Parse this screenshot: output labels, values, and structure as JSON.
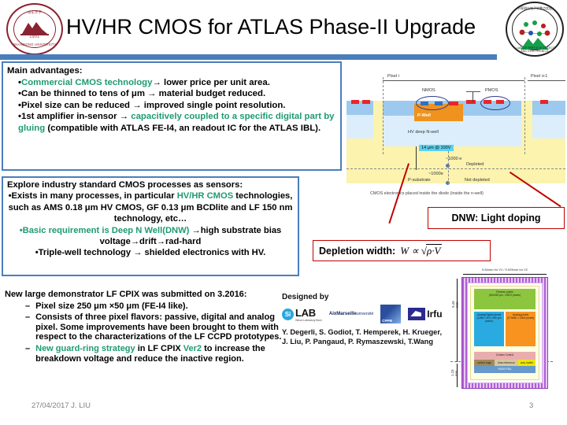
{
  "header": {
    "title": "HV/HR CMOS for ATLAS Phase-II Upgrade",
    "left_logo_name": "Shandong University seal",
    "left_logo_year": "1901",
    "left_logo_arc_bottom": "SHANDONG UNIVERSITY",
    "left_logo_arc_top": "山东大学",
    "right_logo_name": "Key Laboratory of Particle Detection and Electronics",
    "right_logo_cn": "粒子探测与电子学重点实验室",
    "right_logo_en": "KEY LAB OF PARTICLE DETECTION AND ELECTRONICS",
    "accent_color": "#4a7ebb"
  },
  "box_main": {
    "heading": "Main advantages:",
    "bullets": [
      {
        "lead": "•",
        "green1": "Commercial CMOS technology",
        "arrow": "→",
        "rest": " lower price per unit area."
      },
      {
        "lead": "•",
        "plain": "Can be thinned to tens of μm ",
        "arrow": "→",
        "rest": " material budget reduced."
      },
      {
        "lead": "•",
        "plain": "Pixel size can be reduced ",
        "arrow": "→",
        "rest": " improved single point resolution."
      },
      {
        "lead": "•",
        "plain": "1st amplifier in-sensor ",
        "arrow": "→",
        "green1": " capacitively coupled to a specific digital part by gluing",
        "rest": " (compatible with ATLAS FE-I4, an readout IC for the ATLAS IBL)."
      }
    ]
  },
  "box_explore": {
    "heading": "Explore industry standard CMOS processes as sensors:",
    "b1_pre": "•Exists in many processes, in particular ",
    "b1_green": "HV/HR CMOS",
    "b1_rest": "technologies, such as AMS 0.18 μm HV CMOS, GF 0.13 μm BCDlite and LF 150 nm technology, etc…",
    "b2_green": "•Basic requirement is Deep N Well(DNW) ",
    "b2_arrow": "→",
    "b2_rest": "high substrate bias voltage→drift→rad-hard",
    "b3": "•Triple-well technology → shielded electronics with HV."
  },
  "box_demo": {
    "heading": "New large demonstrator LF CPIX was submitted on 3.2016:",
    "items": [
      {
        "dash": "–",
        "text": "Pixel size 250 μm ×50 μm (FE-I4 like)."
      },
      {
        "dash": "–",
        "text": "Consists of three pixel flavors: passive, digital and analog pixel. Some improvements have been brought to them with respect to the characterizations of the LF CCPD prototypes."
      },
      {
        "dash": "–",
        "green_pre": "New guard-ring strategy",
        "mid": " in LF CPIX ",
        "green_mid": "Ver2",
        "rest": " to increase the breakdown voltage and reduce the inactive region."
      }
    ]
  },
  "xsection": {
    "pixel_i": "Pixel i",
    "pixel_i1": "Pixel i+1",
    "nmos": "NMOS",
    "pmos": "PMOS",
    "pwell": "P-Well",
    "hv_deep_nwell": "HV deep N-well",
    "depth_chip": "14 μm @ 100V",
    "e_top": "~1000 e",
    "e_bottom": "~1000e",
    "depleted": "Depleted",
    "not_depleted": "Not depleted",
    "p_substrate": "P-substrate",
    "caption": "CMOS electronics placed inside the diode (inside the n-well)"
  },
  "callouts": {
    "dnw_label": "DNW: Light doping",
    "depletion_label": "Depletion width:",
    "depletion_formula_w": "W",
    "depletion_formula_prop": "∝",
    "depletion_formula_body": "ρ·V",
    "border_color": "#c00000"
  },
  "designed": {
    "heading": "Designed by",
    "logos": [
      {
        "name": "silab-logo",
        "mark": "Si",
        "text": "LAB",
        "sub": "Silicon Laboratory Bonn"
      },
      {
        "name": "aix-marseille-universite-logo",
        "line1": "Aix",
        "line2": "Marseille",
        "line3": "université"
      },
      {
        "name": "cppm-logo",
        "text": "CPPM"
      },
      {
        "name": "irfu-logo",
        "text": "Irfu"
      }
    ],
    "authors_line1": "Y. Degerli, S. Godiot, T. Hemperek, H. Krueger,",
    "authors_line2": "J. Liu, P. Pangaud, P. Rymaszewski, T.Wang"
  },
  "chip_layout": {
    "dim_top": "9.84mm for V1 / 9.925mm for V2",
    "dim_left_1": "9.49 mm",
    "dim_left_2": "1.15 mm",
    "blocks": [
      {
        "name": "passive-pixels",
        "title": "Passive pixels",
        "sub": "(50x250 μm, 13872 pixels)"
      },
      {
        "name": "analog-digital-pixels",
        "title": "Analog/Digital pixels",
        "sub": "(1286 x 50 x 250 μm pixels)"
      },
      {
        "name": "analog-pixels",
        "title": "Analog pixels",
        "sub": "(174x50 = 1604 pixels)"
      },
      {
        "name": "column-control",
        "title": "Column Control"
      },
      {
        "name": "control-logic",
        "title": "control logic"
      },
      {
        "name": "bias-reference",
        "title": "bias reference"
      },
      {
        "name": "analog-buffer",
        "title": "ana. buffer"
      },
      {
        "name": "pads-pda",
        "title": "PADS PDA"
      }
    ]
  },
  "footer": {
    "date_author": "27/04/2017 J. LIU",
    "page": "3"
  }
}
